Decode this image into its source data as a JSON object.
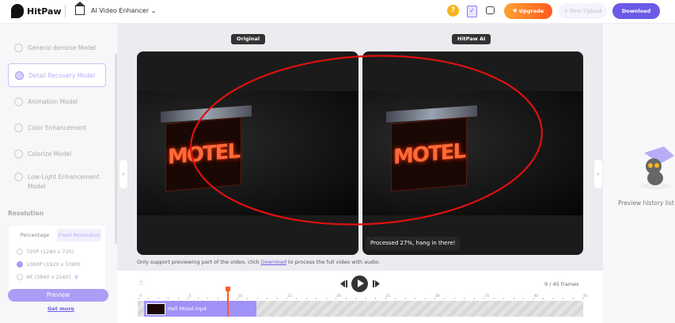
{
  "header": {
    "brand": "HitPaw",
    "product": "AI Video Enhancer",
    "upgrade": "Upgrade",
    "new_upload": "+ New Upload",
    "download": "Download",
    "help_icon": "?"
  },
  "sidebar": {
    "models": [
      {
        "label": "General denoise Model"
      },
      {
        "label": "Detail Recovery Model",
        "active": true
      },
      {
        "label": "Animation Model"
      },
      {
        "label": "Color Enhancement"
      },
      {
        "label": "Colorize Model"
      },
      {
        "label": "Low-Light Enhancement Model"
      }
    ],
    "resolution_title": "Resolution",
    "tabs": [
      "Percentage",
      "Fixed Resolution"
    ],
    "options": [
      {
        "label": "720P (1280 x 720)",
        "checked": false
      },
      {
        "label": "1080P (1920 x 1080)",
        "checked": true
      },
      {
        "label": "4K (3840 x 2160)",
        "checked": false
      }
    ],
    "preview": "Preview",
    "get_more": "Get more"
  },
  "main": {
    "original": "Original",
    "ai": "HitPaw AI",
    "sign_text": "MOTEL",
    "toast": "Processed 27%, hang in there!",
    "note_before": "Only support previewing part of the video, click ",
    "note_link": "Download",
    "note_after": " to process the full video with audio."
  },
  "right": {
    "empty": "Preview history list is"
  },
  "timeline": {
    "frames": "9 / 45 frames",
    "clip_name": "Hell Motel.mp4",
    "current_frame": 9,
    "total_frames": 45,
    "ticks": [
      "0",
      "5",
      "10",
      "15",
      "20",
      "25",
      "30",
      "35",
      "40",
      "45"
    ]
  },
  "colors": {
    "accent": "#6a5ae6",
    "upgrade": "#ff7a26",
    "playhead": "#ff5a1f",
    "annotation": "#e01010"
  }
}
